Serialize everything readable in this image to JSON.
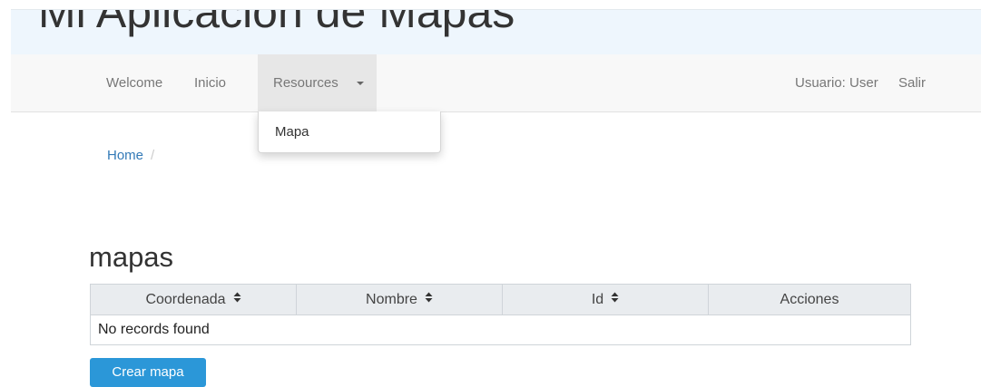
{
  "header": {
    "title": "Mi Aplicacion de Mapas"
  },
  "navbar": {
    "items": [
      "Welcome",
      "Inicio"
    ],
    "resources_label": "Resources",
    "user_label": "Usuario: User",
    "logout_label": "Salir"
  },
  "dropdown": {
    "items": [
      "Mapa"
    ]
  },
  "breadcrumb": {
    "home": "Home",
    "separator": "/"
  },
  "main": {
    "title": "mapas",
    "table": {
      "columns": [
        "Coordenada",
        "Nombre",
        "Id",
        "Acciones"
      ],
      "sortable": [
        true,
        true,
        true,
        false
      ],
      "sort_icon": "sort-icon",
      "empty_message": "No records found"
    },
    "create_button": "Crear mapa"
  },
  "colors": {
    "primary": "#2b97d8",
    "link": "#337ab7",
    "hero_bg": "#eef6fd",
    "navbar_bg": "#f8f8f8",
    "active_tab": "#e7e7e7"
  }
}
